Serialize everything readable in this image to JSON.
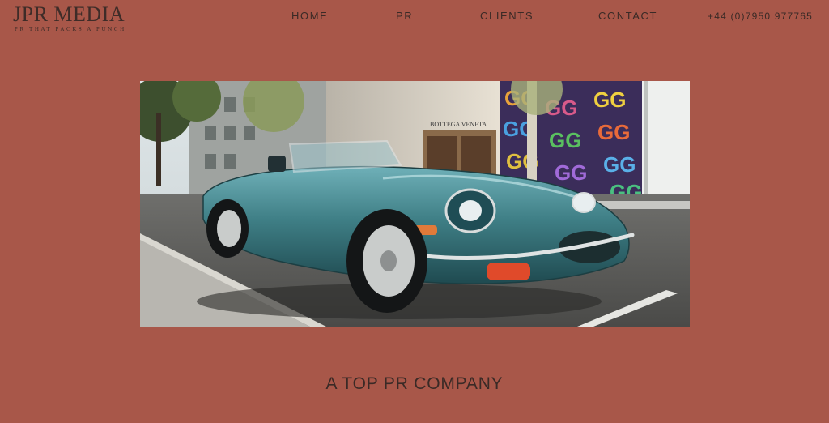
{
  "brand": {
    "title": "JPR MEDIA",
    "tagline": "PR THAT PACKS A PUNCH"
  },
  "nav": {
    "items": [
      {
        "label": "HOME"
      },
      {
        "label": "PR"
      },
      {
        "label": "CLIENTS"
      },
      {
        "label": "CONTACT"
      }
    ],
    "phone": "+44 (0)7950 977765"
  },
  "hero": {
    "storefront_sign": "BOTTEGA VENETA",
    "wall_pattern_letters": "GG"
  },
  "main": {
    "headline": "A TOP PR COMPANY"
  },
  "colors": {
    "background": "#a85749",
    "text": "#3a2a26",
    "car_body": "#3f7f86"
  }
}
